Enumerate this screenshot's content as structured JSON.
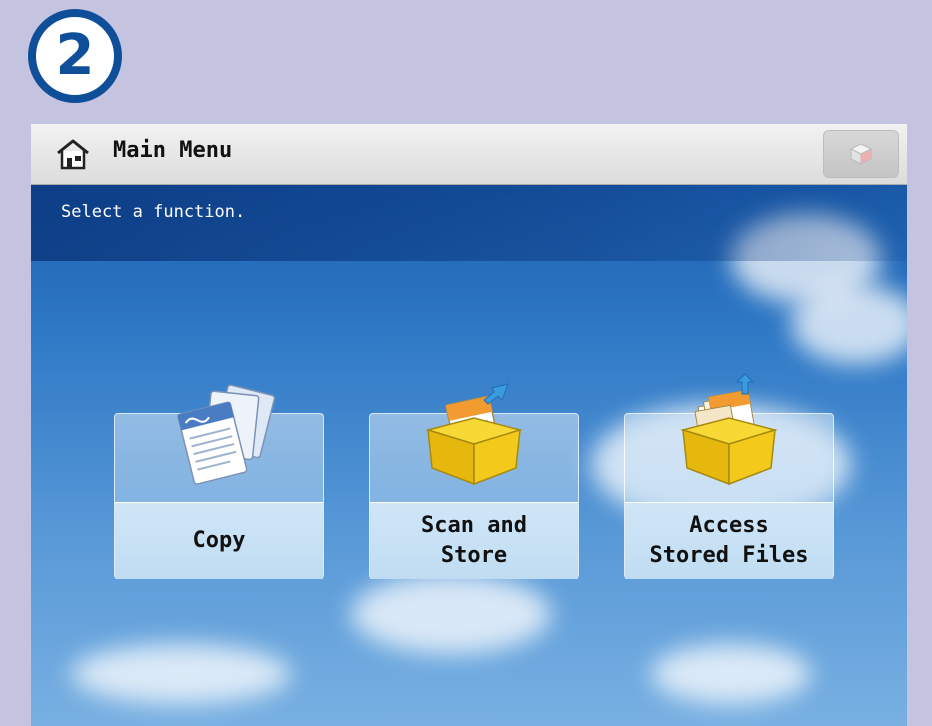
{
  "step": {
    "number": "2"
  },
  "header": {
    "title": "Main Menu"
  },
  "message": {
    "text": "Select a function."
  },
  "functions": [
    {
      "label": "Copy",
      "icon": "copy-icon"
    },
    {
      "label": "Scan and\nStore",
      "icon": "scan-and-store-icon"
    },
    {
      "label": "Access\nStored Files",
      "icon": "access-stored-files-icon"
    }
  ],
  "colors": {
    "badge": "#0f4f9a",
    "background": "#c4c4e0",
    "button_face": "#c0dcf2"
  }
}
